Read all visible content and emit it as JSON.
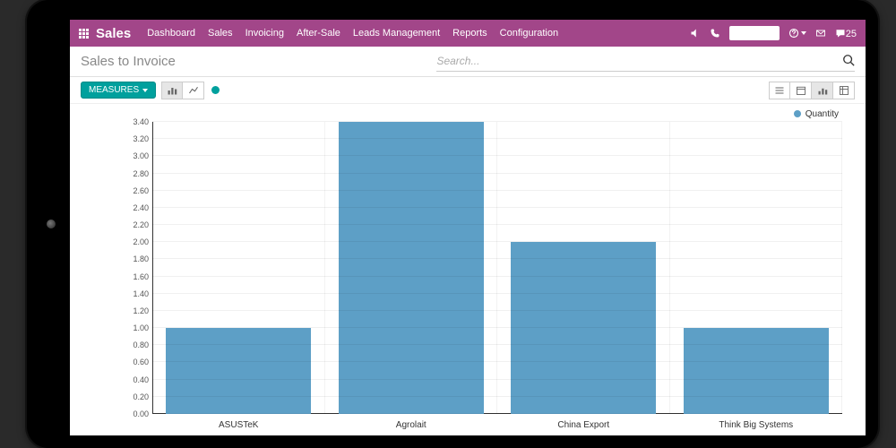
{
  "navbar": {
    "brand": "Sales",
    "links": [
      "Dashboard",
      "Sales",
      "Invoicing",
      "After-Sale",
      "Leads Management",
      "Reports",
      "Configuration"
    ],
    "messages_label": "25"
  },
  "subbar": {
    "title": "Sales to Invoice",
    "search_placeholder": "Search..."
  },
  "controls": {
    "measures_label": "MEASURES"
  },
  "legend": {
    "series_name": "Quantity"
  },
  "chart_data": {
    "type": "bar",
    "categories": [
      "ASUSTeK",
      "Agrolait",
      "China Export",
      "Think Big Systems"
    ],
    "values": [
      1.0,
      3.4,
      2.0,
      1.0
    ],
    "ylabel": "",
    "xlabel": "",
    "ylim": [
      0,
      3.4
    ],
    "y_ticks": [
      "0.00",
      "0.20",
      "0.40",
      "0.60",
      "0.80",
      "1.00",
      "1.20",
      "1.40",
      "1.60",
      "1.80",
      "2.00",
      "2.20",
      "2.40",
      "2.60",
      "2.80",
      "3.00",
      "3.20",
      "3.40"
    ]
  }
}
